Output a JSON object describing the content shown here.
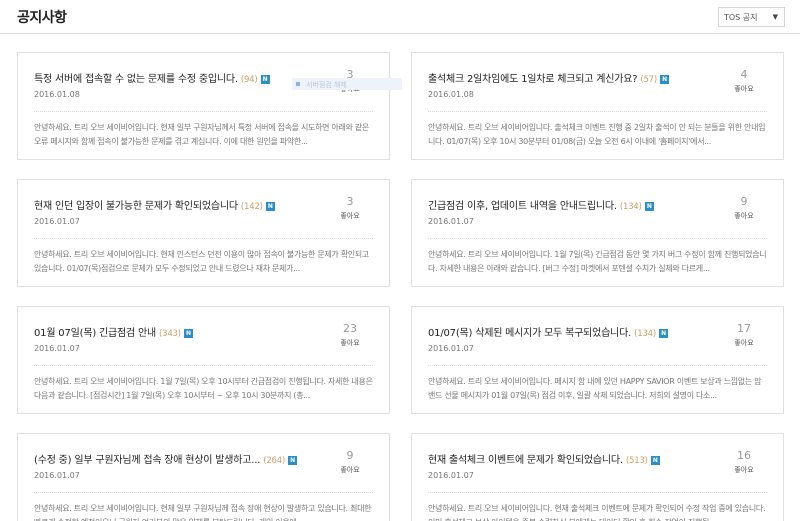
{
  "header": {
    "title": "공지사항",
    "filter": {
      "selected": "TOS 공지",
      "caret": "▼"
    }
  },
  "like_label": "좋아요",
  "new_badge": "N",
  "ghost": {
    "text": "서버점검 해제"
  },
  "cards": [
    {
      "title": "특정 서버에 접속할 수 없는 문제를 수정 중입니다.",
      "count": "(94)",
      "date": "2016.01.08",
      "likes": "3",
      "body": "안녕하세요. 트리 오브 세이비어입니다. 현재 일부 구원자님께서 특정 서버에 접속을 시도하면 아래와 같은 오류 메시지와 함께 접속이 불가능한 문제를 겪고 계십니다. 이에 대한 원인을 파악한..."
    },
    {
      "title": "출석체크 2일차임에도 1일차로 체크되고 계신가요?",
      "count": "(57)",
      "date": "2016.01.08",
      "likes": "4",
      "body": "안녕하세요. 트리 오브 세이비어입니다. 출석체크 이벤트 진행 중 2일차 출석이 안 되는 분들을 위한 안내입니다. 01/07(목) 오후 10시 30분부터 01/08(금) 오늘 오전 6시 이내에 '홈페이지'에서..."
    },
    {
      "title": "현재 인던 입장이 불가능한 문제가 확인되었습니다",
      "count": "(142)",
      "date": "2016.01.07",
      "likes": "3",
      "body": "안녕하세요. 트리 오브 세이비어입니다. 현재 인스턴스 던전 이용이 많아 접속이 불가능한 문제가 확인되고 있습니다. 01/07(목)점검으로 문제가 모두 수정되었고 안내 드렸으나 재차 문제가..."
    },
    {
      "title": "긴급점검 이후, 업데이트 내역을 안내드립니다.",
      "count": "(134)",
      "date": "2016.01.07",
      "likes": "9",
      "body": "안녕하세요. 트리 오브 세이비어입니다. 1월 7일(목) 긴급점검 동안 몇 가지 버그 수정이 함께 진행되었습니다. 자세한 내용은 아래와 같습니다. [버그 수정] 마켓에서 포텐셜 수치가 실제와 다르게..."
    },
    {
      "title": "01월 07일(목) 긴급점검 안내",
      "count": "(343)",
      "date": "2016.01.07",
      "likes": "23",
      "body": "안녕하세요. 트리 오브 세이비어입니다. 1월 7일(목) 오후 10시부터 긴급점검이 진행됩니다. 자세한 내용은 다음과 같습니다. [점검시간] 1월 7일(목) 오후 10시부터 ~ 오후 10시 30분까지 (총..."
    },
    {
      "title": "01/07(목) 삭제된 메시지가 모두 복구되었습니다.",
      "count": "(134)",
      "date": "2016.01.07",
      "likes": "17",
      "body": "안녕하세요. 트리 오브 세이비어입니다. 메시지 함 내에 있던 HAPPY SAVIOR 이벤트 보상과 느낌없는 맘밴드 선물 메시지가 01월 07일(목) 점검 이후, 일괄 삭제 되었습니다. 저희의 설명이 다소..."
    },
    {
      "title": "(수정 중) 일부 구원자님께 접속 장애 현상이 발생하고...",
      "count": "(264)",
      "date": "2016.01.07",
      "likes": "9",
      "body": "안녕하세요. 트리 오브 세이비어입니다. 현재 일부 구원자님께 접속 장애 현상이 발생하고 있습니다. 최대한 빠르게 수정할 예정이오니 구원자 여러분의 많은 양해를 부탁드립니다. 게임 이용에..."
    },
    {
      "title": "현재 출석체크 이벤트에 문제가 확인되었습니다.",
      "count": "(513)",
      "date": "2016.01.07",
      "likes": "16",
      "body": "안녕하세요. 트리 오브 세이비어입니다. 현재 출석체크 이벤트에 문제가 확인되어 수정 작업 중에 있습니다. 이미 출석체크 보상 아이템을 중복 수령하신 분에게는 데이터 확인 후 회수 작업이 진행될..."
    }
  ]
}
